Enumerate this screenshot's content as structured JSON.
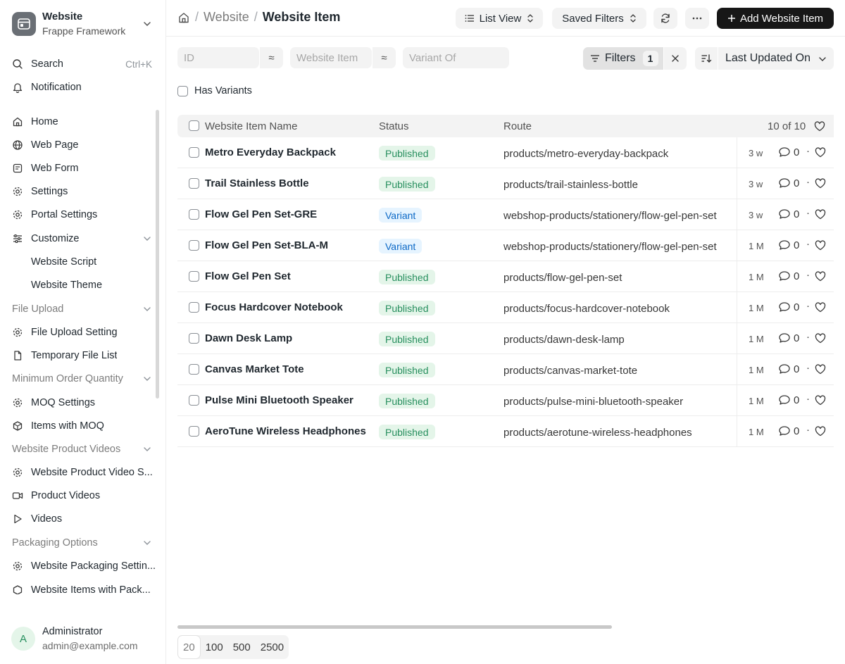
{
  "app": {
    "title": "Website",
    "subtitle": "Frappe Framework"
  },
  "sidebar": {
    "search": {
      "label": "Search",
      "shortcut": "Ctrl+K"
    },
    "notification": {
      "label": "Notification"
    },
    "items": [
      {
        "label": "Home",
        "icon": "home-icon"
      },
      {
        "label": "Web Page",
        "icon": "globe-icon"
      },
      {
        "label": "Web Form",
        "icon": "form-icon"
      },
      {
        "label": "Settings",
        "icon": "gear-icon"
      },
      {
        "label": "Portal Settings",
        "icon": "gear-icon"
      },
      {
        "label": "Customize",
        "icon": "sliders-icon"
      },
      {
        "label": "Website Script"
      },
      {
        "label": "Website Theme"
      }
    ],
    "sections": [
      {
        "label": "File Upload",
        "items": [
          {
            "label": "File Upload Setting"
          },
          {
            "label": "Temporary File List"
          }
        ]
      },
      {
        "label": "Minimum Order Quantity",
        "items": [
          {
            "label": "MOQ Settings"
          },
          {
            "label": "Items with MOQ"
          }
        ]
      },
      {
        "label": "Website Product Videos",
        "items": [
          {
            "label": "Website Product Video S..."
          },
          {
            "label": "Product Videos"
          },
          {
            "label": "Videos"
          }
        ]
      },
      {
        "label": "Packaging Options",
        "items": [
          {
            "label": "Website Packaging Settin..."
          },
          {
            "label": "Website Items with Pack..."
          }
        ]
      }
    ],
    "user": {
      "initial": "A",
      "name": "Administrator",
      "email": "admin@example.com"
    }
  },
  "header": {
    "breadcrumb": [
      "Website",
      "Website Item"
    ],
    "list_view": "List View",
    "saved_filters": "Saved Filters",
    "add_button": "Add Website Item"
  },
  "filters": {
    "id_placeholder": "ID",
    "item_placeholder": "Website Item",
    "variant_placeholder": "Variant Of",
    "filters_label": "Filters",
    "filters_count": "1",
    "sort_label": "Last Updated On",
    "has_variants": "Has Variants"
  },
  "table": {
    "columns": [
      "Website Item Name",
      "Status",
      "Route"
    ],
    "count": "10 of 10",
    "rows": [
      {
        "name": "Metro Everyday Backpack",
        "status": "Published",
        "route": "products/metro-everyday-backpack",
        "time": "3 w",
        "comments": "0"
      },
      {
        "name": "Trail Stainless Bottle",
        "status": "Published",
        "route": "products/trail-stainless-bottle",
        "time": "3 w",
        "comments": "0"
      },
      {
        "name": "Flow Gel Pen Set-GRE",
        "status": "Variant",
        "route": "webshop-products/stationery/flow-gel-pen-set",
        "time": "3 w",
        "comments": "0"
      },
      {
        "name": "Flow Gel Pen Set-BLA-M",
        "status": "Variant",
        "route": "webshop-products/stationery/flow-gel-pen-set",
        "time": "1 M",
        "comments": "0"
      },
      {
        "name": "Flow Gel Pen Set",
        "status": "Published",
        "route": "products/flow-gel-pen-set",
        "time": "1 M",
        "comments": "0"
      },
      {
        "name": "Focus Hardcover Notebook",
        "status": "Published",
        "route": "products/focus-hardcover-notebook",
        "time": "1 M",
        "comments": "0"
      },
      {
        "name": "Dawn Desk Lamp",
        "status": "Published",
        "route": "products/dawn-desk-lamp",
        "time": "1 M",
        "comments": "0"
      },
      {
        "name": "Canvas Market Tote",
        "status": "Published",
        "route": "products/canvas-market-tote",
        "time": "1 M",
        "comments": "0"
      },
      {
        "name": "Pulse Mini Bluetooth Speaker",
        "status": "Published",
        "route": "products/pulse-mini-bluetooth-speaker",
        "time": "1 M",
        "comments": "0"
      },
      {
        "name": "AeroTune Wireless Headphones",
        "status": "Published",
        "route": "products/aerotune-wireless-headphones",
        "time": "1 M",
        "comments": "0"
      }
    ]
  },
  "pagination": {
    "sizes": [
      "20",
      "100",
      "500",
      "2500"
    ],
    "active": "20"
  },
  "colors": {
    "primary_button": "#171717",
    "published": "#278f5e",
    "variant": "#0b68c6"
  }
}
